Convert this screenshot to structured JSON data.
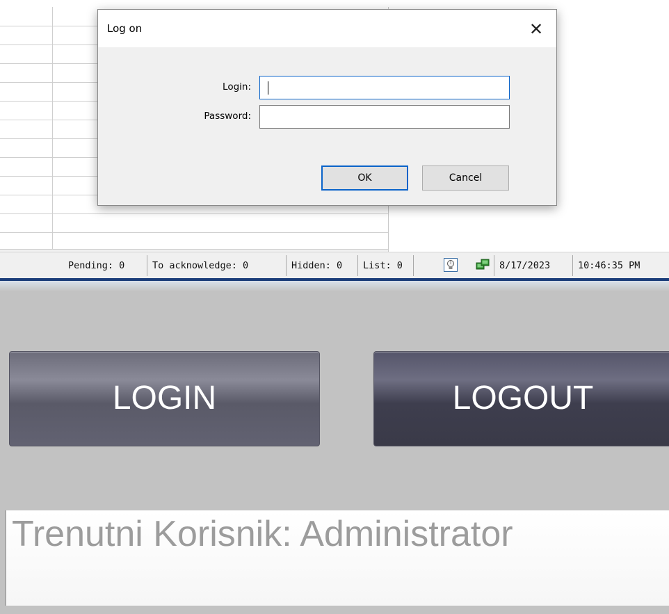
{
  "dialog": {
    "title": "Log on",
    "close_icon": "close-icon",
    "login_label": "Login:",
    "login_value": "",
    "password_label": "Password:",
    "password_value": "",
    "ok_label": "OK",
    "cancel_label": "Cancel"
  },
  "statusbar": {
    "pending": "Pending: 0",
    "to_acknowledge": "To acknowledge: 0",
    "hidden": "Hidden: 0",
    "list": "List: 0",
    "icons": [
      "lightbulb-icon",
      "network-icon"
    ],
    "date": "8/17/2023",
    "time": "10:46:35 PM"
  },
  "panel": {
    "login_button": "LOGIN",
    "logout_button": "LOGOUT",
    "current_user": "Trenutni Korisnik: Administrator"
  },
  "colors": {
    "focus_accent": "#0a63c9",
    "login_button": "#6c6c7a",
    "logout_button": "#44445a",
    "user_text": "#9c9c9c"
  }
}
